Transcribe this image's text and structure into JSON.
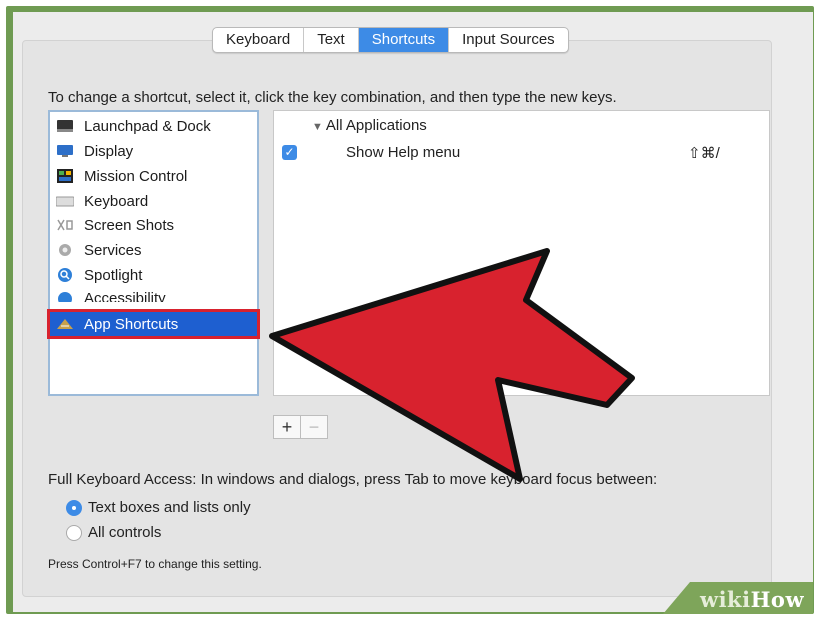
{
  "tabs": [
    {
      "label": "Keyboard",
      "active": false
    },
    {
      "label": "Text",
      "active": false
    },
    {
      "label": "Shortcuts",
      "active": true
    },
    {
      "label": "Input Sources",
      "active": false
    }
  ],
  "instructions": "To change a shortcut, select it, click the key combination, and then type the new keys.",
  "categories": [
    {
      "label": "Launchpad & Dock",
      "icon": "launchpad-dock-icon"
    },
    {
      "label": "Display",
      "icon": "display-icon"
    },
    {
      "label": "Mission Control",
      "icon": "mission-control-icon"
    },
    {
      "label": "Keyboard",
      "icon": "keyboard-icon"
    },
    {
      "label": "Screen Shots",
      "icon": "screenshot-icon"
    },
    {
      "label": "Services",
      "icon": "gear-icon"
    },
    {
      "label": "Spotlight",
      "icon": "search-icon"
    },
    {
      "label": "Accessibility",
      "icon": "accessibility-icon"
    },
    {
      "label": "App Shortcuts",
      "icon": "app-shortcuts-icon",
      "selected": true
    }
  ],
  "shortcut_panel": {
    "group_label": "All Applications",
    "rows": [
      {
        "checked": true,
        "label": "Show Help menu",
        "keys": "⇧⌘/"
      }
    ]
  },
  "add_remove": {
    "add": "+",
    "remove": "−"
  },
  "full_keyboard_access": {
    "label": "Full Keyboard Access: In windows and dialogs, press Tab to move keyboard focus between:",
    "options": [
      {
        "label": "Text boxes and lists only",
        "selected": true
      },
      {
        "label": "All controls",
        "selected": false
      }
    ],
    "hint": "Press Control+F7 to change this setting."
  },
  "watermark": {
    "part1": "wiki",
    "part2": "How"
  },
  "colors": {
    "accent": "#3d8be6",
    "selection": "#1e5fd0",
    "arrow": "#d8222e",
    "frame": "#6f9b52"
  }
}
